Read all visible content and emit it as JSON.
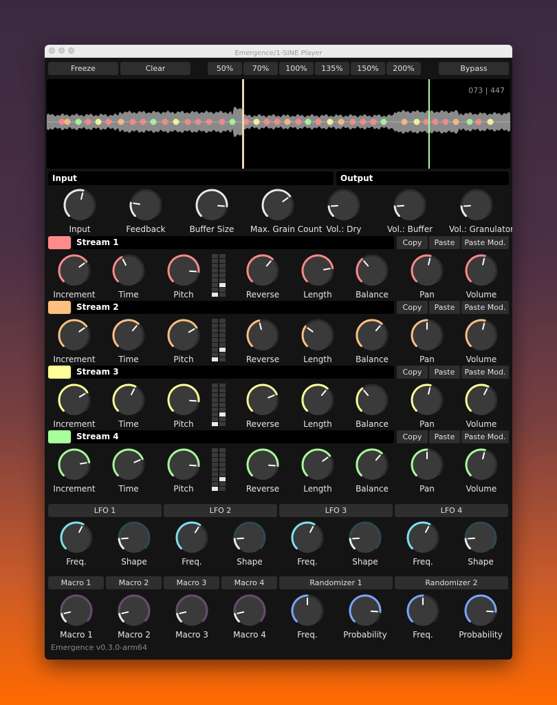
{
  "window": {
    "title": "Emergence/1-SINE Player",
    "version": "Emergence v0.3.0-arm64"
  },
  "toolbar": {
    "freeze": "Freeze",
    "clear": "Clear",
    "speeds": [
      "50%",
      "70%",
      "100%",
      "135%",
      "150%",
      "200%"
    ],
    "bypass": "Bypass"
  },
  "waveform": {
    "counter": "073 | 447"
  },
  "sections": {
    "input": "Input",
    "output": "Output"
  },
  "io_knobs": [
    {
      "label": "Input",
      "value": 0.55
    },
    {
      "label": "Feedback",
      "value": 0.2
    },
    {
      "label": "Buffer Size",
      "value": 0.85
    },
    {
      "label": "Max. Grain Count",
      "value": 0.7
    },
    {
      "label": "Vol.: Dry",
      "value": 0.15
    },
    {
      "label": "Vol.: Buffer",
      "value": 0.15
    },
    {
      "label": "Vol.: Granulator",
      "value": 0.15
    }
  ],
  "stream_buttons": {
    "copy": "Copy",
    "paste": "Paste",
    "paste_mod": "Paste Mod."
  },
  "streams": [
    {
      "name": "Stream 1",
      "color": "#ff8a8a",
      "knobs": [
        {
          "label": "Increment",
          "value": 0.7
        },
        {
          "label": "Time",
          "value": 0.4
        },
        {
          "label": "Pitch",
          "value": 0.85
        },
        {
          "label": "Reverse",
          "value": 0.65
        },
        {
          "label": "Length",
          "value": 0.8
        },
        {
          "label": "Balance",
          "value": 0.35
        },
        {
          "label": "Pan",
          "value": 0.55
        },
        {
          "label": "Volume",
          "value": 0.55
        }
      ]
    },
    {
      "name": "Stream 2",
      "color": "#ffc080",
      "knobs": [
        {
          "label": "Increment",
          "value": 0.7
        },
        {
          "label": "Time",
          "value": 0.65
        },
        {
          "label": "Pitch",
          "value": 0.72
        },
        {
          "label": "Reverse",
          "value": 0.45
        },
        {
          "label": "Length",
          "value": 0.3
        },
        {
          "label": "Balance",
          "value": 0.65
        },
        {
          "label": "Pan",
          "value": 0.5
        },
        {
          "label": "Volume",
          "value": 0.55
        }
      ]
    },
    {
      "name": "Stream 3",
      "color": "#ffff99",
      "knobs": [
        {
          "label": "Increment",
          "value": 0.72
        },
        {
          "label": "Time",
          "value": 0.6
        },
        {
          "label": "Pitch",
          "value": 0.85
        },
        {
          "label": "Reverse",
          "value": 0.75
        },
        {
          "label": "Length",
          "value": 0.65
        },
        {
          "label": "Balance",
          "value": 0.35
        },
        {
          "label": "Pan",
          "value": 0.55
        },
        {
          "label": "Volume",
          "value": 0.6
        }
      ]
    },
    {
      "name": "Stream 4",
      "color": "#a8ff9a",
      "knobs": [
        {
          "label": "Increment",
          "value": 0.8
        },
        {
          "label": "Time",
          "value": 0.75
        },
        {
          "label": "Pitch",
          "value": 0.85
        },
        {
          "label": "Reverse",
          "value": 0.85
        },
        {
          "label": "Length",
          "value": 0.7
        },
        {
          "label": "Balance",
          "value": 0.65
        },
        {
          "label": "Pan",
          "value": 0.5
        },
        {
          "label": "Volume",
          "value": 0.55
        }
      ]
    }
  ],
  "lfos": [
    {
      "name": "LFO 1",
      "freq": 0.6,
      "shape": 0.15
    },
    {
      "name": "LFO 2",
      "freq": 0.62,
      "shape": 0.15
    },
    {
      "name": "LFO 3",
      "freq": 0.6,
      "shape": 0.15
    },
    {
      "name": "LFO 4",
      "freq": 0.6,
      "shape": 0.15
    }
  ],
  "lfo_labels": {
    "freq": "Freq.",
    "shape": "Shape"
  },
  "macros": [
    {
      "name": "Macro 1",
      "label": "Macro 1",
      "value": 0.12
    },
    {
      "name": "Macro 2",
      "label": "Macro 2",
      "value": 0.12
    },
    {
      "name": "Macro 3",
      "label": "Macro 3",
      "value": 0.12
    },
    {
      "name": "Macro 4",
      "label": "Macro 4",
      "value": 0.12
    }
  ],
  "randomizers": [
    {
      "name": "Randomizer 1",
      "freq": 0.5,
      "probability": 0.85
    },
    {
      "name": "Randomizer 2",
      "freq": 0.5,
      "probability": 0.85
    }
  ],
  "rand_labels": {
    "freq": "Freq.",
    "probability": "Probability"
  },
  "colors": {
    "lfo": "#7fe0f0",
    "macro": "#6a4a70",
    "randomizer": "#7aa6ff"
  }
}
